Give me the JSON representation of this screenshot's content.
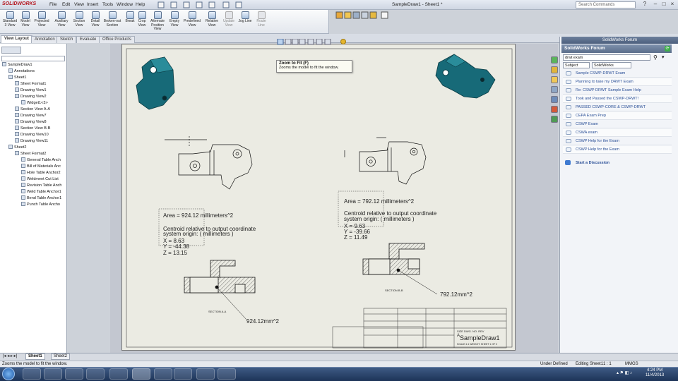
{
  "app": {
    "logo_text": "SOLIDWORKS",
    "document_title": "SampleDraw1 - Sheet1 *",
    "search_placeholder": "Search Commands"
  },
  "menus": [
    "File",
    "Edit",
    "View",
    "Insert",
    "Tools",
    "Window",
    "Help"
  ],
  "ribbon_tools": [
    {
      "label": "Standard 3 View",
      "enabled": true
    },
    {
      "label": "Model View",
      "enabled": true
    },
    {
      "label": "Projected View",
      "enabled": true
    },
    {
      "label": "Auxiliary View",
      "enabled": true
    },
    {
      "label": "Section View",
      "enabled": true
    },
    {
      "label": "Detail View",
      "enabled": true
    },
    {
      "label": "Broken-out Section",
      "enabled": true
    },
    {
      "label": "Break",
      "enabled": true
    },
    {
      "label": "Crop View",
      "enabled": true
    },
    {
      "label": "Alternate Position View",
      "enabled": true
    },
    {
      "label": "Empty View",
      "enabled": true
    },
    {
      "label": "Predefined View",
      "enabled": true
    },
    {
      "label": "Relative View",
      "enabled": true
    },
    {
      "label": "Update View",
      "enabled": false
    },
    {
      "label": "Jog Line",
      "enabled": true
    },
    {
      "label": "Route Line",
      "enabled": false
    }
  ],
  "command_tabs": [
    "View Layout",
    "Annotation",
    "Sketch",
    "Evaluate",
    "Office Products"
  ],
  "active_tab": "View Layout",
  "tree": [
    {
      "label": "SampleDraw1",
      "level": 0
    },
    {
      "label": "Annotations",
      "level": 1
    },
    {
      "label": "Sheet1",
      "level": 1
    },
    {
      "label": "Sheet Format1",
      "level": 2
    },
    {
      "label": "Drawing View1",
      "level": 2
    },
    {
      "label": "Drawing View2",
      "level": 2
    },
    {
      "label": "Widget1<3>",
      "level": 3
    },
    {
      "label": "Section View A-A",
      "level": 2
    },
    {
      "label": "Drawing View7",
      "level": 2
    },
    {
      "label": "Drawing View8",
      "level": 2
    },
    {
      "label": "Section View B-B",
      "level": 2
    },
    {
      "label": "Drawing View10",
      "level": 2
    },
    {
      "label": "Drawing View11",
      "level": 2
    },
    {
      "label": "Sheet2",
      "level": 1
    },
    {
      "label": "Sheet Format2",
      "level": 2
    },
    {
      "label": "General Table Anch",
      "level": 3
    },
    {
      "label": "Bill of Materials Anc",
      "level": 3
    },
    {
      "label": "Hole Table Anchor2",
      "level": 3
    },
    {
      "label": "Weldment Cut List",
      "level": 3
    },
    {
      "label": "Revision Table Anch",
      "level": 3
    },
    {
      "label": "Weld Table Anchor1",
      "level": 3
    },
    {
      "label": "Bend Table Anchor1",
      "level": 3
    },
    {
      "label": "Punch Table Ancho",
      "level": 3
    }
  ],
  "tooltip": {
    "title": "Zoom to Fit",
    "shortcut": "(F)",
    "desc": "Zooms the model to fit the window."
  },
  "drawing": {
    "left_props": [
      "Area = 924.12 millimeters^2",
      "Centroid relative to output coordinate",
      "system origin: ( millimeters )",
      "X = 8.63",
      "Y = -44.38",
      "Z = 13.15"
    ],
    "right_props": [
      "Area = 792.12 millimeters^2",
      "Centroid relative to output coordinate",
      "system origin: ( millimeters )",
      "X = 9.63",
      "Y = -39.66",
      "Z = 11.49"
    ],
    "section_left": "SECTION A-A",
    "section_right": "SECTION B-B",
    "left_area": "924.12mm^2",
    "right_area": "792.12mm^2",
    "title_block_name": "SampleDraw1",
    "scale_text": "SCALE:1:1   WEIGHT:   SHEET 1 OF 2",
    "size_text": "SIZE DWG. NO.  REV",
    "size_value": "A"
  },
  "right_panel": {
    "header": "SolidWorks Forum",
    "title": "SolidWorks Forum",
    "search_value": "drwt exam",
    "select1": "Subject",
    "select2": "SolidWorks",
    "posts": [
      "Sample CSWP-DRWT Exam",
      "Planning to take my DRWT Exam",
      "Re: CSWP DRWT Sample Exam Help",
      "Took and Passed the CSWP-DRWT!",
      "PASSED CSWP-CORE & CSWP-DRWT",
      "CEPA Exam Prep",
      "CSWP Exam",
      "CSWA exam",
      "CSWP Help for the Exam",
      "CSWP Help for the Exam"
    ],
    "discussion": "Start a Discussion"
  },
  "sheet_tabs": [
    "Sheet1",
    "Sheet2"
  ],
  "status": {
    "message": "Zooms the model to fit the window.",
    "state": "Under Defined",
    "editing": "Editing Sheet1",
    "scale": "1 : 1",
    "units": "MMGS"
  },
  "clock": {
    "time": "4:24 PM",
    "date": "11/4/2013"
  },
  "colors": {
    "part": "#176a78",
    "accent": "#b4141c"
  }
}
